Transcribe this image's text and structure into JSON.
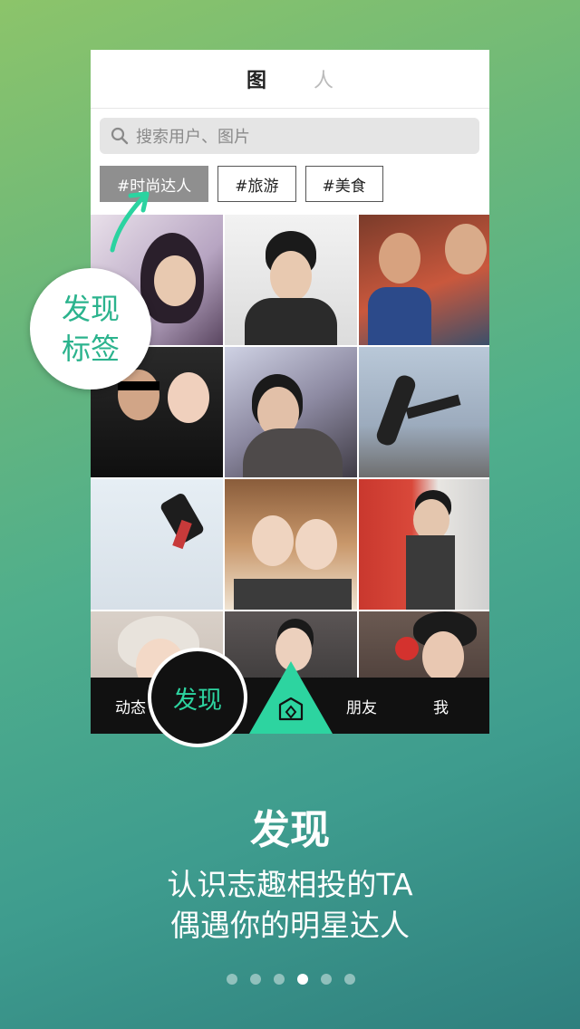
{
  "header": {
    "tabs": [
      {
        "label": "图"
      },
      {
        "label": "人"
      }
    ]
  },
  "search": {
    "placeholder": "搜索用户、图片"
  },
  "tags": [
    {
      "label": "#时尚达人"
    },
    {
      "label": "#旅游"
    },
    {
      "label": "#美食"
    }
  ],
  "callout": {
    "line1": "发现",
    "line2": "标签"
  },
  "bottom_nav": {
    "dynamic": "动态",
    "discover": "发现",
    "friends": "朋友",
    "me": "我"
  },
  "promo": {
    "title": "发现",
    "line1": "认识志趣相投的TA",
    "line2": "偶遇你的明星达人"
  },
  "pager": {
    "active_index": 3,
    "count": 6
  },
  "colors": {
    "accent": "#2dd4a0",
    "callout_text": "#2bb38d"
  }
}
